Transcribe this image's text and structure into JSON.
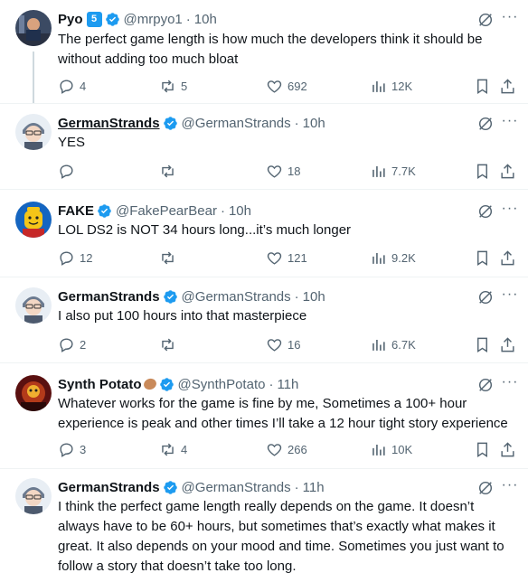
{
  "tweets": [
    {
      "name": "Pyo",
      "badge": "5",
      "handle": "@mrpyo1",
      "time": "10h",
      "text": "The perfect game length is how much the developers think it should be without adding too much bloat",
      "replies": "4",
      "reposts": "5",
      "likes": "692",
      "views": "12K",
      "avatar": "pyo-avatar"
    },
    {
      "name": "GermanStrands",
      "handle": "@GermanStrands",
      "time": "10h",
      "text": "YES",
      "replies": "",
      "reposts": "",
      "likes": "18",
      "views": "7.7K",
      "avatar": "germanstrands-avatar"
    },
    {
      "name": "FAKE",
      "handle": "@FakePearBear",
      "time": "10h",
      "text": "LOL DS2 is NOT 34 hours long...it’s much longer",
      "replies": "12",
      "reposts": "",
      "likes": "121",
      "views": "9.2K",
      "avatar": "fake-avatar"
    },
    {
      "name": "GermanStrands",
      "handle": "@GermanStrands",
      "time": "10h",
      "text": "I also put 100 hours into that masterpiece",
      "replies": "2",
      "reposts": "",
      "likes": "16",
      "views": "6.7K",
      "avatar": "germanstrands-avatar"
    },
    {
      "name": "Synth Potato",
      "handle": "@SynthPotato",
      "time": "11h",
      "text": "Whatever works for the game is fine by me, Sometimes a 100+ hour experience is peak and other times I’ll take a 12 hour tight story experience",
      "replies": "3",
      "reposts": "4",
      "likes": "266",
      "views": "10K",
      "avatar": "synthpotato-avatar"
    },
    {
      "name": "GermanStrands",
      "handle": "@GermanStrands",
      "time": "11h",
      "text": "I think the perfect game length really depends on the game. It doesn’t always have to be 60+ hours, but sometimes that’s exactly what makes it great. It also depends on your mood and time. Sometimes you just want to follow a story that doesn’t take too long.",
      "avatar": "germanstrands-avatar"
    }
  ],
  "separator": "·",
  "colors": {
    "verified": "#1d9bf0",
    "muted": "#536471",
    "text": "#0f1419",
    "divider": "#eff3f4"
  }
}
